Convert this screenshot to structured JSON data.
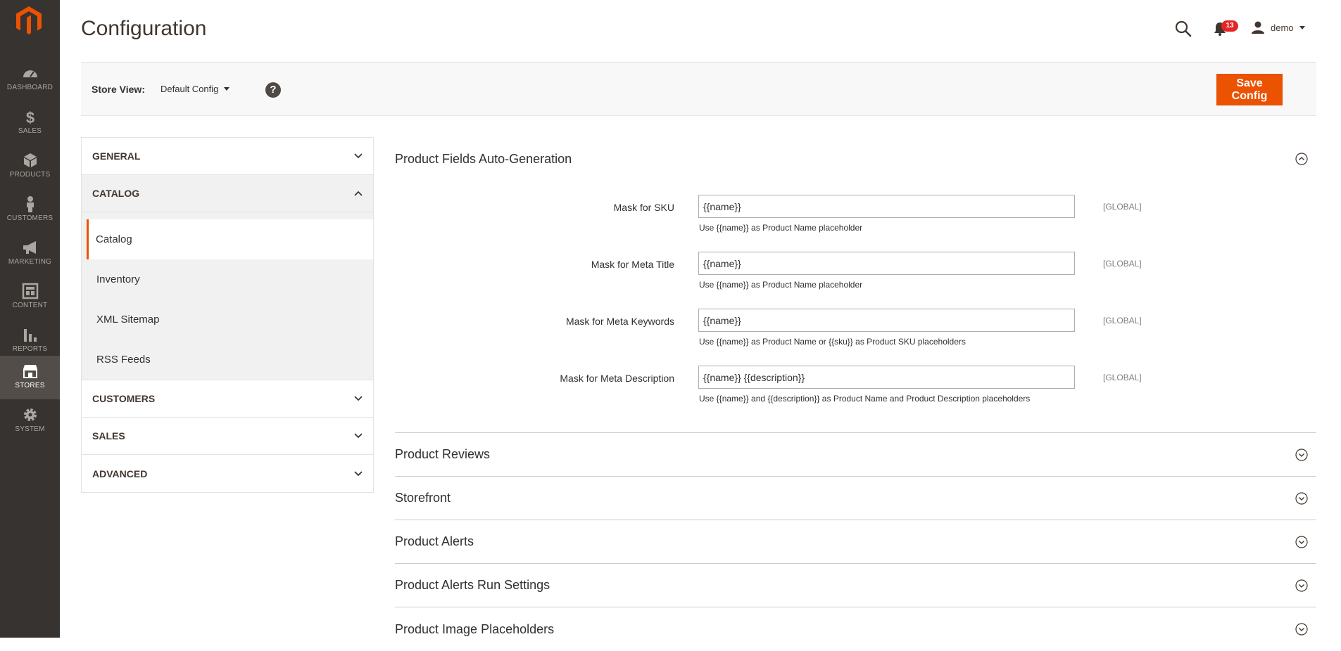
{
  "nav": {
    "items": [
      {
        "label": "DASHBOARD",
        "icon": "dashboard-icon"
      },
      {
        "label": "SALES",
        "icon": "dollar-icon"
      },
      {
        "label": "PRODUCTS",
        "icon": "box-icon"
      },
      {
        "label": "CUSTOMERS",
        "icon": "person-icon"
      },
      {
        "label": "MARKETING",
        "icon": "megaphone-icon"
      },
      {
        "label": "CONTENT",
        "icon": "layout-icon"
      },
      {
        "label": "REPORTS",
        "icon": "bar-chart-icon"
      },
      {
        "label": "STORES",
        "icon": "store-icon"
      },
      {
        "label": "SYSTEM",
        "icon": "gear-icon"
      }
    ],
    "active": "STORES"
  },
  "header": {
    "title": "Configuration",
    "notification_count": "13",
    "user": "demo"
  },
  "store_view": {
    "label": "Store View:",
    "value": "Default Config",
    "help": "?"
  },
  "save_button": "Save Config",
  "tabs": [
    {
      "label": "GENERAL"
    },
    {
      "label": "CATALOG",
      "items": [
        "Catalog",
        "Inventory",
        "XML Sitemap",
        "RSS Feeds"
      ]
    },
    {
      "label": "CUSTOMERS"
    },
    {
      "label": "SALES"
    },
    {
      "label": "ADVANCED"
    }
  ],
  "sections": {
    "open": {
      "title": "Product Fields Auto-Generation",
      "fields": [
        {
          "label": "Mask for SKU",
          "value": "{{name}}",
          "note": "Use {{name}} as Product Name placeholder",
          "scope": "[GLOBAL]"
        },
        {
          "label": "Mask for Meta Title",
          "value": "{{name}}",
          "note": "Use {{name}} as Product Name placeholder",
          "scope": "[GLOBAL]"
        },
        {
          "label": "Mask for Meta Keywords",
          "value": "{{name}}",
          "note": "Use {{name}} as Product Name or {{sku}} as Product SKU placeholders",
          "scope": "[GLOBAL]"
        },
        {
          "label": "Mask for Meta Description",
          "value": "{{name}} {{description}}",
          "note": "Use {{name}} and {{description}} as Product Name and Product Description placeholders",
          "scope": "[GLOBAL]"
        }
      ]
    },
    "collapsed": [
      "Product Reviews",
      "Storefront",
      "Product Alerts",
      "Product Alerts Run Settings",
      "Product Image Placeholders"
    ]
  },
  "colors": {
    "accent": "#eb5202",
    "nav_bg": "#373330"
  }
}
